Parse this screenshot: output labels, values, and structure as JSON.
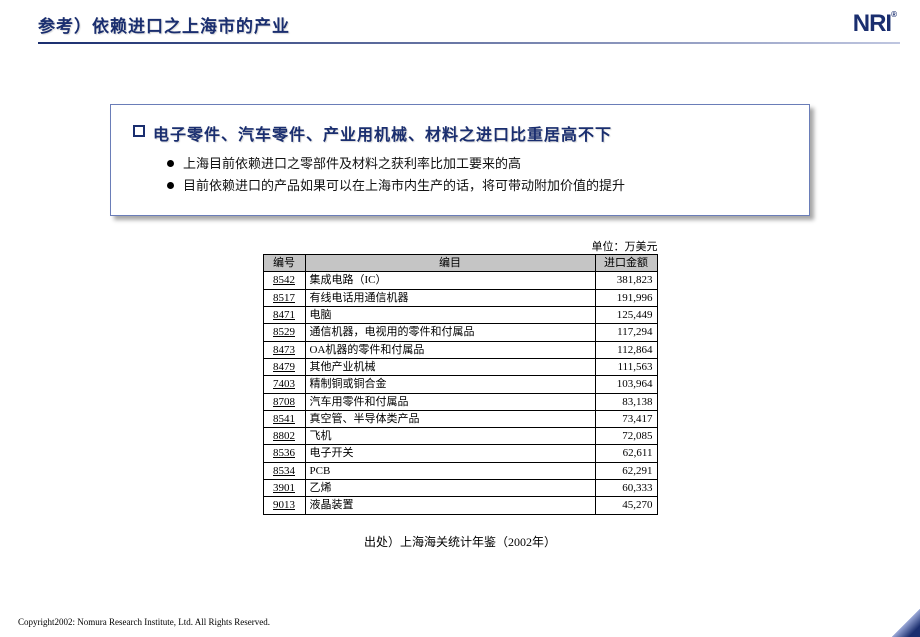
{
  "header": {
    "title": "参考）依赖进口之上海市的产业",
    "logo": "NRI",
    "logo_mark": "®"
  },
  "callout": {
    "title": "电子零件、汽车零件、产业用机械、材料之进口比重居高不下",
    "points": [
      "上海目前依赖进口之零部件及材料之获利率比加工要来的高",
      "目前依赖进口的产品如果可以在上海市内生产的话，将可带动附加价值的提升"
    ]
  },
  "table": {
    "unit": "单位：万美元",
    "headers": {
      "code": "编号",
      "item": "编目",
      "amount": "进口金额"
    },
    "rows": [
      {
        "code": "8542",
        "item": "集成电路（IC）",
        "amount": "381,823"
      },
      {
        "code": "8517",
        "item": "有线电话用通信机器",
        "amount": "191,996"
      },
      {
        "code": "8471",
        "item": "电脑",
        "amount": "125,449"
      },
      {
        "code": "8529",
        "item": "通信机器，电视用的零件和付属品",
        "amount": "117,294"
      },
      {
        "code": "8473",
        "item": "OA机器的零件和付属品",
        "amount": "112,864"
      },
      {
        "code": "8479",
        "item": "其他产业机械",
        "amount": "111,563"
      },
      {
        "code": "7403",
        "item": "精制铜或铜合金",
        "amount": "103,964"
      },
      {
        "code": "8708",
        "item": "汽车用零件和付属品",
        "amount": "83,138"
      },
      {
        "code": "8541",
        "item": "真空管、半导体类产品",
        "amount": "73,417"
      },
      {
        "code": "8802",
        "item": "飞机",
        "amount": "72,085"
      },
      {
        "code": "8536",
        "item": "电子开关",
        "amount": "62,611"
      },
      {
        "code": "8534",
        "item": "PCB",
        "amount": "62,291"
      },
      {
        "code": "3901",
        "item": "乙烯",
        "amount": "60,333"
      },
      {
        "code": "9013",
        "item": "液晶装置",
        "amount": "45,270"
      }
    ],
    "source": "出处）上海海关统计年鉴（2002年）"
  },
  "footer": {
    "copyright": "Copyright2002: Nomura Research Institute, Ltd. All Rights Reserved."
  },
  "chart_data": {
    "type": "table",
    "title": "参考）依赖进口之上海市的产业",
    "unit": "万美元",
    "columns": [
      "编号",
      "编目",
      "进口金额"
    ],
    "rows": [
      [
        "8542",
        "集成电路（IC）",
        381823
      ],
      [
        "8517",
        "有线电话用通信机器",
        191996
      ],
      [
        "8471",
        "电脑",
        125449
      ],
      [
        "8529",
        "通信机器，电视用的零件和付属品",
        117294
      ],
      [
        "8473",
        "OA机器的零件和付属品",
        112864
      ],
      [
        "8479",
        "其他产业机械",
        111563
      ],
      [
        "7403",
        "精制铜或铜合金",
        103964
      ],
      [
        "8708",
        "汽车用零件和付属品",
        83138
      ],
      [
        "8541",
        "真空管、半导体类产品",
        73417
      ],
      [
        "8802",
        "飞机",
        72085
      ],
      [
        "8536",
        "电子开关",
        62611
      ],
      [
        "8534",
        "PCB",
        62291
      ],
      [
        "3901",
        "乙烯",
        60333
      ],
      [
        "9013",
        "液晶装置",
        45270
      ]
    ],
    "source": "上海海关统计年鉴（2002年）"
  }
}
